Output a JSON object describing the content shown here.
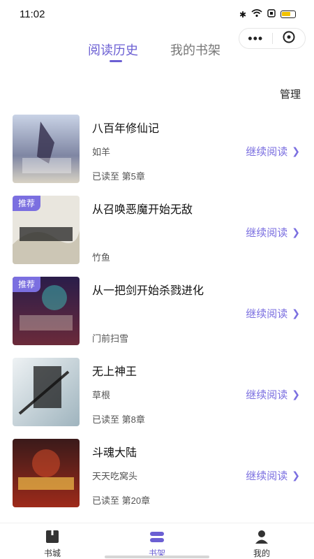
{
  "status": {
    "time": "11:02"
  },
  "tabs": [
    {
      "label": "阅读历史",
      "active": true
    },
    {
      "label": "我的书架",
      "active": false
    }
  ],
  "manage_label": "管理",
  "continue_label": "继续阅读",
  "books": [
    {
      "title": "八百年修仙记",
      "author": "如羊",
      "progress": "已读至 第5章",
      "badge": "",
      "cover_text": "八百年修仙记"
    },
    {
      "title": "从召唤恶魔开始无敌",
      "author": "竹鱼",
      "progress": "",
      "badge": "推荐",
      "cover_text": "从召唤恶魔开始无敌"
    },
    {
      "title": "从一把剑开始杀戮进化",
      "author": "门前扫雪",
      "progress": "",
      "badge": "推荐",
      "cover_text": "从一把剑开始杀戮进化"
    },
    {
      "title": "无上神王",
      "author": "草根",
      "progress": "已读至 第8章",
      "badge": "",
      "cover_text": "无上神王"
    },
    {
      "title": "斗魂大陆",
      "author": "天天吃窝头",
      "progress": "已读至 第20章",
      "badge": "",
      "cover_text": "斗魂大陆"
    }
  ],
  "nav": [
    {
      "label": "书城",
      "icon": "book-icon",
      "active": false
    },
    {
      "label": "书架",
      "icon": "shelf-icon",
      "active": true
    },
    {
      "label": "我的",
      "icon": "user-icon",
      "active": false
    }
  ],
  "colors": {
    "accent": "#6b5fd3",
    "badge": "#7b6fe0"
  }
}
